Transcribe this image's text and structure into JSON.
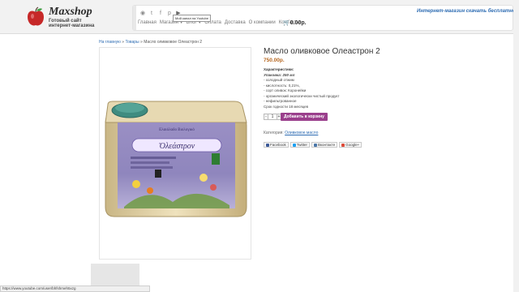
{
  "logo": {
    "title": "Maxshop",
    "subtitle_line1": "Готовый сайт",
    "subtitle_line2": "интернет-магазина"
  },
  "tagline": "Интернет-магазин скачать бесплатно",
  "socials": [
    {
      "icon": "rss-icon",
      "glyph": "◉"
    },
    {
      "icon": "twitter-icon",
      "glyph": "t"
    },
    {
      "icon": "facebook-icon",
      "glyph": "f"
    },
    {
      "icon": "pinterest-icon",
      "glyph": "p"
    },
    {
      "icon": "youtube-icon",
      "glyph": "▶"
    }
  ],
  "tooltip": "Мой канал на Youtube",
  "menu": {
    "home": "Главная",
    "shop": "Магазин",
    "blog": "Блог",
    "payment": "Оплата",
    "delivery": "Доставка",
    "about": "О компании",
    "contacts": "Контакты"
  },
  "cart_total": "0.00р.",
  "breadcrumb": {
    "home": "На главную",
    "goods": "Товары",
    "current": "Масло оливковое Олеастрон 2",
    "sep": "»"
  },
  "product": {
    "title": "Масло оливковое Олеастрон 2",
    "price": "750.00р.",
    "char_heading": "Характеристики:",
    "pack": "Упаковка: 250 мл",
    "features": [
      "- холодный отжим",
      "- кислотность: 0,21%,",
      "- сорт оливок: Коронейки",
      "- органический экологически чистый продукт",
      "- нефильтрованное",
      "Срок годности 18 месяцев"
    ],
    "qty": "1",
    "qty_minus": "-",
    "qty_plus": "+",
    "add_to_cart": "Добавить в корзину",
    "category_label": "Категория:",
    "category": "Оливковое масло",
    "can_brand": "Ὀλεάστρον",
    "can_top": "Ελαιόλαδο Βιολογικό"
  },
  "share": [
    {
      "label": "Facebook",
      "color": "#3b5998"
    },
    {
      "label": "Twitter",
      "color": "#1da1f2"
    },
    {
      "label": "Вконтакте",
      "color": "#4a76a8"
    },
    {
      "label": "Google+",
      "color": "#dd4b39"
    }
  ],
  "status_url": "https://www.youtube.com/user/bhfshmeh5xzg"
}
